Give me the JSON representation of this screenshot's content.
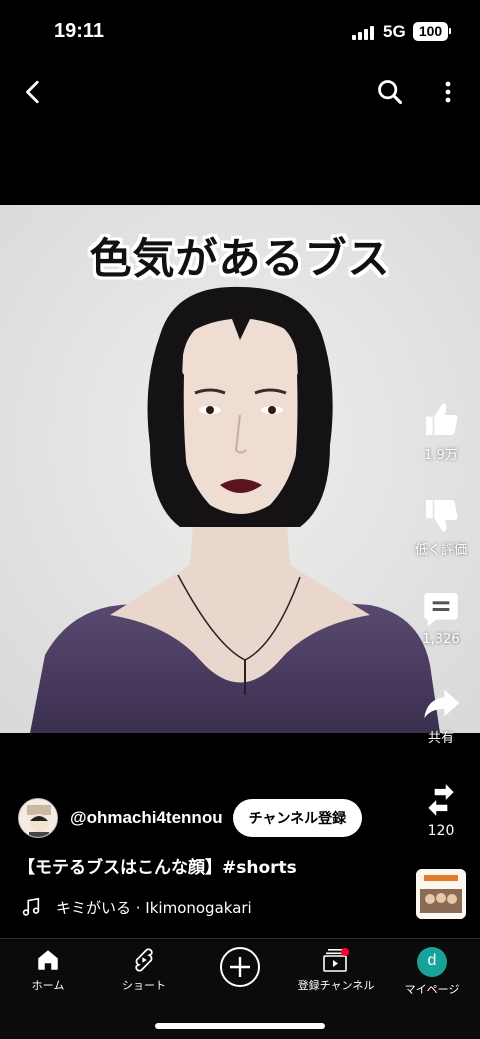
{
  "status": {
    "time": "19:11",
    "network": "5G",
    "battery": "100"
  },
  "top_nav": {
    "back_icon": "chevron-left-icon",
    "search_icon": "search-icon",
    "more_icon": "vertical-dots-icon"
  },
  "video": {
    "caption": "色気があるブス"
  },
  "actions": {
    "like": {
      "icon": "thumbs-up-icon",
      "label": "1.9万"
    },
    "dislike": {
      "icon": "thumbs-down-icon",
      "label": "低く評価"
    },
    "comments": {
      "icon": "comment-icon",
      "label": "1,326"
    },
    "share": {
      "icon": "share-arrow-icon",
      "label": "共有"
    },
    "remix": {
      "icon": "remix-icon",
      "label": "120"
    }
  },
  "channel": {
    "handle": "@ohmachi4tennou",
    "subscribe_label": "チャンネル登録"
  },
  "title": "【モテるブスはこんな顔】#shorts",
  "music": {
    "icon": "music-note-icon",
    "text": "キミがいる · Ikimonogakari"
  },
  "bottom_nav": {
    "home": "ホーム",
    "shorts": "ショート",
    "subscriptions": "登録チャンネル",
    "you": "マイページ",
    "avatar_letter": "d"
  },
  "colors": {
    "background": "#000000",
    "accent_red": "#ff0033",
    "avatar_teal": "#17a39a"
  }
}
